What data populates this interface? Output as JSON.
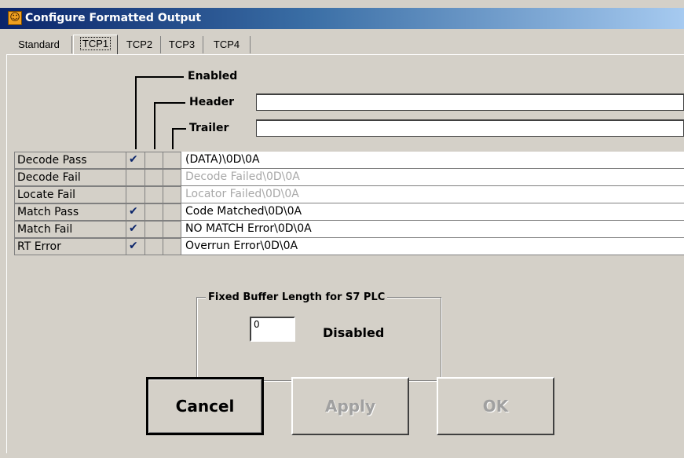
{
  "window": {
    "title": "Configure Formatted Output",
    "icon": "running-figure-icon"
  },
  "tabs": [
    {
      "label": "Standard",
      "active": false
    },
    {
      "label": "TCP1",
      "active": true
    },
    {
      "label": "TCP2",
      "active": false
    },
    {
      "label": "TCP3",
      "active": false
    },
    {
      "label": "TCP4",
      "active": false
    }
  ],
  "labels": {
    "enabled": "Enabled",
    "header": "Header",
    "trailer": "Trailer"
  },
  "header_value": "",
  "trailer_value": "",
  "rows": [
    {
      "label": "Decode Pass",
      "enabled": true,
      "header": false,
      "trailer": false,
      "text": "(DATA)\\0D\\0A",
      "text_disabled": false
    },
    {
      "label": "Decode Fail",
      "enabled": false,
      "header": false,
      "trailer": false,
      "text": "Decode Failed\\0D\\0A",
      "text_disabled": true
    },
    {
      "label": "Locate Fail",
      "enabled": false,
      "header": false,
      "trailer": false,
      "text": "Locator Failed\\0D\\0A",
      "text_disabled": true
    },
    {
      "label": "Match Pass",
      "enabled": true,
      "header": false,
      "trailer": false,
      "text": "Code Matched\\0D\\0A",
      "text_disabled": false
    },
    {
      "label": "Match Fail",
      "enabled": true,
      "header": false,
      "trailer": false,
      "text": "NO MATCH Error\\0D\\0A",
      "text_disabled": false
    },
    {
      "label": "RT Error",
      "enabled": true,
      "header": false,
      "trailer": false,
      "text": "Overrun Error\\0D\\0A",
      "text_disabled": false
    }
  ],
  "buffer": {
    "title": "Fixed Buffer Length for S7 PLC",
    "value": "0",
    "status": "Disabled"
  },
  "buttons": {
    "cancel": "Cancel",
    "apply": "Apply",
    "ok": "OK"
  },
  "check_glyph": "✔"
}
